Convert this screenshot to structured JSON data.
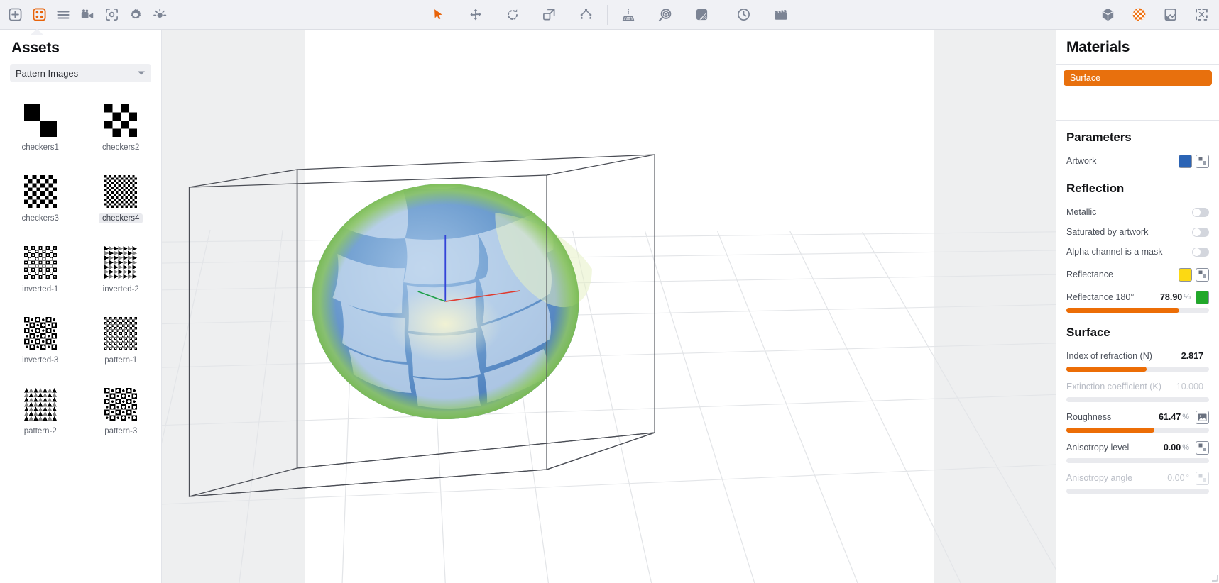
{
  "toolbar": {
    "left_items": [
      {
        "name": "add-icon",
        "label": "Add",
        "selected": false
      },
      {
        "name": "assets-grid-icon",
        "label": "Assets",
        "selected": true
      },
      {
        "name": "list-menu-icon",
        "label": "List",
        "selected": false
      },
      {
        "name": "video-camera-icon",
        "label": "Camera",
        "selected": false
      },
      {
        "name": "snapshot-icon",
        "label": "Snapshot",
        "selected": false
      },
      {
        "name": "gear-icon",
        "label": "Settings",
        "selected": false
      },
      {
        "name": "light-bulb-icon",
        "label": "Lighting",
        "selected": false
      }
    ],
    "center_items": [
      {
        "name": "select-arrow-icon",
        "label": "Select",
        "selected": true
      },
      {
        "name": "move-icon",
        "label": "Move",
        "selected": false
      },
      {
        "name": "rotate-icon",
        "label": "Rotate",
        "selected": false
      },
      {
        "name": "scale-icon",
        "label": "Scale",
        "selected": false
      },
      {
        "name": "distribute-icon",
        "label": "Distribute",
        "selected": false
      },
      {
        "name": "perspective-icon",
        "label": "Perspective",
        "selected": false
      },
      {
        "name": "inspect-object-icon",
        "label": "Inspect",
        "selected": false
      },
      {
        "name": "texture-gradient-icon",
        "label": "Texture",
        "selected": false
      },
      {
        "name": "render-time-icon",
        "label": "Render Time",
        "selected": false
      },
      {
        "name": "animation-clapper-icon",
        "label": "Animation",
        "selected": false
      }
    ],
    "right_items": [
      {
        "name": "cube-icon",
        "label": "Geometry",
        "selected": false
      },
      {
        "name": "checkered-sphere-icon",
        "label": "Materials",
        "selected": true
      },
      {
        "name": "background-image-icon",
        "label": "Background",
        "selected": false
      },
      {
        "name": "fullscreen-icon",
        "label": "Fullscreen",
        "selected": false
      }
    ]
  },
  "assets": {
    "title": "Assets",
    "category_selected": "Pattern Images",
    "category_options": [
      "Pattern Images"
    ],
    "items": [
      {
        "label": "checkers1",
        "pattern": "checkers1",
        "selected": false
      },
      {
        "label": "checkers2",
        "pattern": "checkers2",
        "selected": false
      },
      {
        "label": "checkers3",
        "pattern": "checkers3",
        "selected": false
      },
      {
        "label": "checkers4",
        "pattern": "checkers4",
        "selected": true
      },
      {
        "label": "inverted-1",
        "pattern": "inverted1",
        "selected": false
      },
      {
        "label": "inverted-2",
        "pattern": "inverted2",
        "selected": false
      },
      {
        "label": "inverted-3",
        "pattern": "inverted3",
        "selected": false
      },
      {
        "label": "pattern-1",
        "pattern": "pattern1",
        "selected": false
      },
      {
        "label": "pattern-2",
        "pattern": "pattern2",
        "selected": false
      },
      {
        "label": "pattern-3",
        "pattern": "pattern3",
        "selected": false
      }
    ]
  },
  "viewport": {
    "object": "sphere",
    "has_bounding_box": true,
    "has_ground_grid": true,
    "axis_colors": {
      "x": "#e03b2f",
      "y": "#1ea04a",
      "z": "#2f3fd0"
    },
    "sphere_colors": {
      "base": "#4a7fc1",
      "checker": "#c9dcf0",
      "rim": "#8fc863",
      "highlight": "#f2f0c8"
    },
    "background": "#ffffff",
    "band_color": "#eeeff0"
  },
  "materials": {
    "title": "Materials",
    "items": [
      {
        "label": "Surface",
        "selected": true
      }
    ],
    "accent_color": "#e8700d",
    "parameters": {
      "heading": "Parameters",
      "rows": [
        {
          "label": "Artwork",
          "type": "color-pattern",
          "color": "#2b64b5",
          "pattern_button": true,
          "disabled": false
        }
      ]
    },
    "reflection": {
      "heading": "Reflection",
      "toggles": [
        {
          "label": "Metallic",
          "value": false
        },
        {
          "label": "Saturated by artwork",
          "value": false
        },
        {
          "label": "Alpha channel is a mask",
          "value": false
        }
      ],
      "rows": [
        {
          "label": "Reflectance",
          "type": "color-pattern",
          "color": "#fcd913",
          "pattern_button": true,
          "disabled": false
        },
        {
          "label": "Reflectance 180°",
          "type": "value-color-slider",
          "value": "78.90",
          "unit": "%",
          "color": "#21a82a",
          "slider_pct": 78.9,
          "disabled": false
        }
      ]
    },
    "surface": {
      "heading": "Surface",
      "rows": [
        {
          "label": "Index of refraction (N)",
          "value": "2.817",
          "unit": "",
          "slider_pct": 56,
          "disabled": false,
          "button": null
        },
        {
          "label": "Extinction coefficient (K)",
          "value": "10.000",
          "unit": "",
          "slider_pct": 0,
          "disabled": true,
          "button": null
        },
        {
          "label": "Roughness",
          "value": "61.47",
          "unit": "%",
          "slider_pct": 61.47,
          "disabled": false,
          "button": "image-icon"
        },
        {
          "label": "Anisotropy level",
          "value": "0.00",
          "unit": "%",
          "slider_pct": 0,
          "disabled": false,
          "button": "pattern-icon"
        },
        {
          "label": "Anisotropy angle",
          "value": "0.00",
          "unit": "°",
          "slider_pct": 0,
          "disabled": true,
          "button": "pattern-icon"
        }
      ]
    }
  }
}
